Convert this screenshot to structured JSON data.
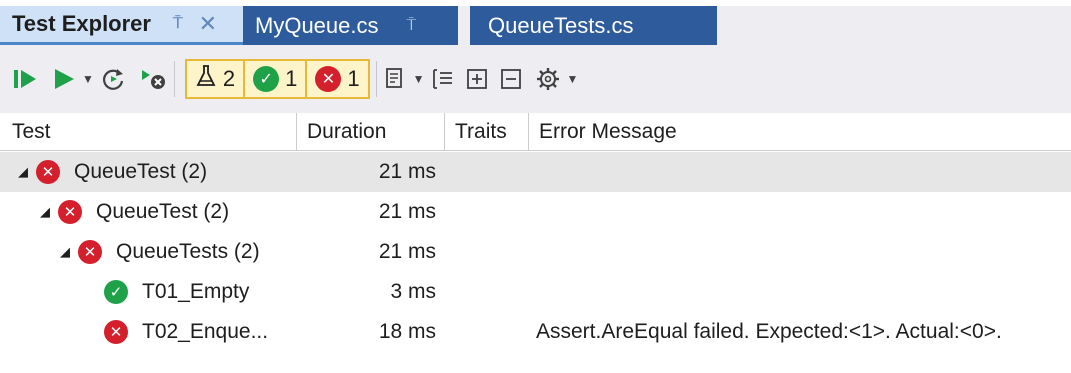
{
  "tabs": {
    "active_label": "Test Explorer",
    "pin_glyph": "⍑",
    "close_glyph": "✕",
    "doc1_label": "MyQueue.cs",
    "doc2_label": "QueueTests.cs"
  },
  "toolbar": {
    "filter_all_count": "2",
    "filter_passed_count": "1",
    "filter_failed_count": "1"
  },
  "columns": {
    "test": "Test",
    "duration": "Duration",
    "traits": "Traits",
    "error": "Error Message"
  },
  "rows": [
    {
      "name": "QueueTest (2)",
      "duration": "21 ms",
      "error": "",
      "status": "failed",
      "expanded": true
    },
    {
      "name": "QueueTest (2)",
      "duration": "21 ms",
      "error": "",
      "status": "failed",
      "expanded": true
    },
    {
      "name": "QueueTests (2)",
      "duration": "21 ms",
      "error": "",
      "status": "failed",
      "expanded": true
    },
    {
      "name": "T01_Empty",
      "duration": "3 ms",
      "error": "",
      "status": "passed"
    },
    {
      "name": "T02_Enque...",
      "duration": "18 ms",
      "error": "Assert.AreEqual failed. Expected:<1>. Actual:<0>.",
      "status": "failed"
    }
  ],
  "colors": {
    "passed": "#1fa14a",
    "failed": "#d41f2c",
    "tab_active_bg": "#cfe1f7",
    "tab_doc_bg": "#2d5b9b",
    "filter_highlight": "#fdf4c9"
  },
  "icons": {
    "run_all": "run-all-icon",
    "run": "run-icon",
    "rerun_failed": "rerun-failed-icon",
    "cancel": "cancel-run-icon",
    "flask": "flask-icon",
    "passed": "passed-icon",
    "failed": "failed-icon",
    "playlist": "playlist-icon",
    "group_by": "group-by-icon",
    "expand_all": "expand-all-icon",
    "collapse_all": "collapse-all-icon",
    "settings": "settings-icon"
  }
}
